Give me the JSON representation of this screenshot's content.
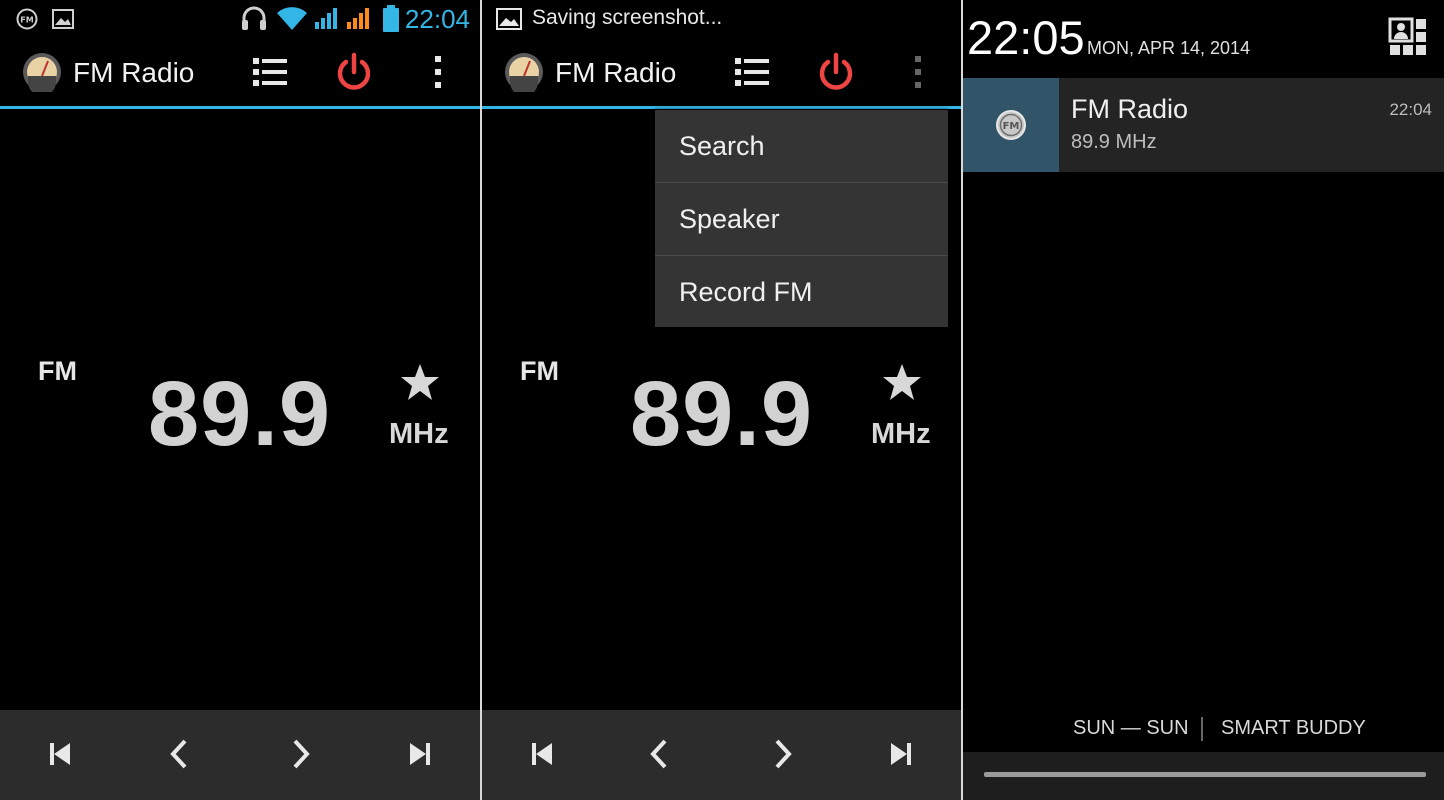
{
  "colors": {
    "accent": "#33b5e5",
    "power": "#ee4444",
    "notif_icon_bg": "#315468",
    "bottom_bar": "#2c2c2c"
  },
  "panel1": {
    "status": {
      "time": "22:04"
    },
    "app_title": "FM Radio",
    "band": "FM",
    "frequency": "89.9",
    "unit": "MHz"
  },
  "panel2": {
    "status": {
      "text": "Saving screenshot..."
    },
    "app_title": "FM Radio",
    "band": "FM",
    "frequency": "89.9",
    "unit": "MHz",
    "menu": [
      "Search",
      "Speaker",
      "Record FM"
    ]
  },
  "panel3": {
    "time": "22:05",
    "date": "MON, APR 14, 2014",
    "notification": {
      "title": "FM Radio",
      "subtitle": "89.9 MHz",
      "time": "22:04",
      "icon_text": "FM"
    },
    "carrier1": "SUN — SUN",
    "carrier2": "SMART BUDDY"
  }
}
